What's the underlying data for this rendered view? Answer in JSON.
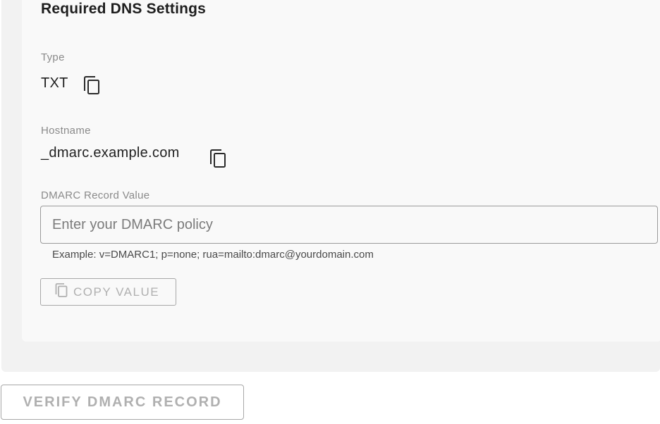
{
  "section": {
    "title": "Required DNS Settings"
  },
  "type_field": {
    "label": "Type",
    "value": "TXT"
  },
  "hostname_field": {
    "label": "Hostname",
    "value": "_dmarc.example.com"
  },
  "record_field": {
    "label": "DMARC Record Value",
    "value": "",
    "placeholder": "Enter your DMARC policy",
    "helper": "Example: v=DMARC1; p=none; rua=mailto:dmarc@yourdomain.com"
  },
  "copy_value_button": {
    "label": "COPY VALUE",
    "icon": "copy-icon",
    "disabled": true
  },
  "verify_button": {
    "label": "VERIFY DMARC RECORD",
    "disabled": true
  },
  "icons": {
    "copy": "copy-icon"
  },
  "colors": {
    "panel_background": "#f2f2f2",
    "card_background": "#f9f9f9",
    "disabled_text": "#b0b0b0",
    "label_text": "#8a8a8a"
  }
}
